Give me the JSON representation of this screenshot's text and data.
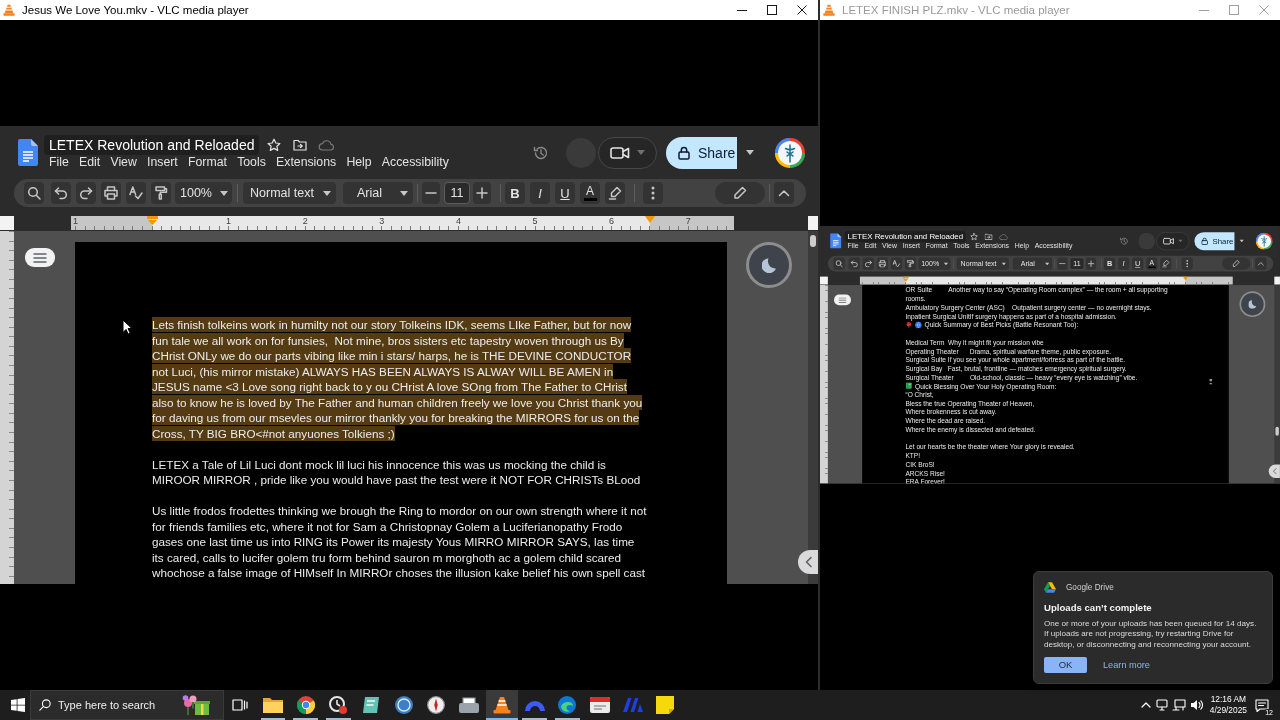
{
  "windows": [
    {
      "title": "Jesus We Love You.mkv - VLC media player",
      "active": true,
      "docs": {
        "title": "LETEX Revolution and Reloaded",
        "menus": [
          "File",
          "Edit",
          "View",
          "Insert",
          "Format",
          "Tools",
          "Extensions",
          "Help",
          "Accessibility"
        ],
        "share": "Share",
        "toolbar": {
          "zoom": "100%",
          "style": "Normal text",
          "font": "Arial",
          "size": "11",
          "format": [
            {
              "kind": "bold",
              "label": "B"
            },
            {
              "kind": "italic",
              "label": "I"
            },
            {
              "kind": "underline",
              "label": "U"
            },
            {
              "kind": "text_color",
              "label": "A"
            }
          ]
        },
        "ruler": [
          "1",
          "1",
          "2",
          "3",
          "4",
          "5",
          "6",
          "7"
        ],
        "sections": [
          {
            "paragraphs": [
              {
                "text": "Lets finish tolkeins work in humilty not our story Tolkeins IDK, seems LIke Father, but for now\nfun tale we all work on for funsies,  Not mine, bros sisters etc tapestry woven through us By\nCHrist ONLy we do our parts vibing like min i stars/ harps, he is THE DEVINE CONDUCTOR\nnot Luci, (his mirror mistake) ALWAYS HAS BEEN ALWAYS IS ALWAY WILL BE AMEN in\nJESUS name <3 Love song right back to y ou CHrist A love SOng from The Father to CHrist\nalso to know he is loved by The Father and human children freely we love you Christ thank you\nfor daving us from our msevles our mirror thankly you for breaking the MIRRORS for us on the\nCross, TY BIG BRO<#not anyuones Tolkiens ;)",
                "highlighted": true
              }
            ]
          },
          {
            "paragraphs": [
              {
                "text": "LETEX a Tale of Lil Luci dont mock lil luci his innocence this was us mocking the child is\nMIROOR MIRROR , pride like you would have past the test were it NOT FOR CHRISTs BLood",
                "highlighted": false
              }
            ]
          },
          {
            "paragraphs": [
              {
                "text": "Us little frodos frodettes thinking we brough the Ring to mordor on our own strength where it not\nfor friends families etc, where it not for Sam a Christopnay Golem a Luciferianopathy Frodo\ngases one last time us into RING its Power its majesty Yous MIRRO MIRROR SAYS, las time\nits cared, calls to lucifer golem tru form behind sauron m morghoth ac a golem child scared\nwhochose a false image of HIMself In MIRROr choses the illusion kake belief his own spell cast",
                "highlighted": false
              }
            ]
          }
        ]
      }
    },
    {
      "title": "LETEX FINISH PLZ.mkv - VLC media player",
      "active": false,
      "docs": {
        "title": "LETEX Revolution and Reloaded",
        "menus": [
          "File",
          "Edit",
          "View",
          "Insert",
          "Format",
          "Tools",
          "Extensions",
          "Help",
          "Accessibility"
        ],
        "share": "Share",
        "toolbar": {
          "zoom": "100%",
          "style": "Normal text",
          "font": "Arial",
          "size": "11",
          "format": [
            {
              "kind": "bold",
              "label": "B"
            },
            {
              "kind": "italic",
              "label": "I"
            },
            {
              "kind": "underline",
              "label": "U"
            },
            {
              "kind": "text_color",
              "label": "A"
            }
          ]
        },
        "sections": [
          {
            "paragraphs": [
              {
                "kind": "text",
                "text": "OR Suite         Another way to say “Operating Room complex” — the room + all supporting\nrooms."
              },
              {
                "kind": "text",
                "text": "Ambulatory Surgery Center (ASC)    Outpatient surgery center — no overnight stays."
              },
              {
                "kind": "text",
                "text": "Inpatient Surgical UnitIf surgery happens as part of a hospital admission."
              },
              {
                "kind": "summary_heading",
                "text": "Quick Summary of Best Picks (Battle Resonant Too):"
              }
            ]
          },
          {
            "paragraphs": [
              {
                "kind": "text",
                "text": "Medical Term  Why it might fit your mission vibe"
              },
              {
                "kind": "text",
                "text": "Operating Theater      Drama, spiritual warfare theme, public exposure."
              },
              {
                "kind": "text",
                "text": "Surgical Suite If you see your whole apartment/fortress as part of the battle."
              },
              {
                "kind": "text",
                "text": "Surgical Bay   Fast, brutal, frontline — matches emergency spiritual surgery."
              },
              {
                "kind": "text",
                "text": "Surgical Theater         Old-school, classic — heavy “every eye is watching” vibe."
              },
              {
                "kind": "blessing_heading",
                "text": "Quick Blessing Over Your Holy Operating Room:"
              },
              {
                "kind": "text",
                "text": "“O Christ,"
              },
              {
                "kind": "text",
                "text": "Bless the true Operating Theater of Heaven,"
              },
              {
                "kind": "text",
                "text": "Where brokenness is cut away."
              },
              {
                "kind": "text",
                "text": "Where the dead are raised."
              },
              {
                "kind": "text",
                "text": "Where the enemy is dissected and defeated."
              }
            ]
          },
          {
            "paragraphs": [
              {
                "kind": "text",
                "text": "Let our hearts be the theater where Your glory is revealed."
              },
              {
                "kind": "text",
                "text": "KTP!"
              },
              {
                "kind": "text",
                "text": "CIK BroS!"
              },
              {
                "kind": "text",
                "text": "ARCKS Rise!"
              },
              {
                "kind": "text",
                "text": "ERA Forever!"
              }
            ]
          }
        ]
      }
    }
  ],
  "notification": {
    "app": "Google Drive",
    "title": "Uploads can’t complete",
    "body": "One or more of your uploads has been queued for 14 days.\nIf uploads are not progressing, try restarting Drive for\ndesktop, or disconnecting and reconnecting your account.",
    "buttons": [
      {
        "kind": "primary",
        "label": "OK"
      },
      {
        "kind": "link",
        "label": "Learn more"
      }
    ]
  },
  "taskbar": {
    "search": {
      "placeholder": "Type here to search"
    },
    "apps": [
      {
        "kind": "folder",
        "running": true,
        "selected": false
      },
      {
        "kind": "chrome",
        "running": true,
        "selected": false
      },
      {
        "kind": "badge",
        "running": true,
        "selected": false
      },
      {
        "kind": "tile",
        "running": false,
        "selected": false
      },
      {
        "kind": "qb",
        "running": false,
        "selected": false
      },
      {
        "kind": "compass",
        "running": false,
        "selected": false
      },
      {
        "kind": "scanner",
        "running": false,
        "selected": false
      },
      {
        "kind": "vlc",
        "running": true,
        "selected": true
      },
      {
        "kind": "arc",
        "running": true,
        "selected": false
      },
      {
        "kind": "edge",
        "running": true,
        "selected": false
      },
      {
        "kind": "window",
        "running": false,
        "selected": false
      },
      {
        "kind": "wing",
        "running": false,
        "selected": false
      },
      {
        "kind": "note",
        "running": false,
        "selected": false
      }
    ],
    "clock": {
      "time": "12:16 AM",
      "date": "4/29/2025"
    },
    "notification_count": "12"
  }
}
